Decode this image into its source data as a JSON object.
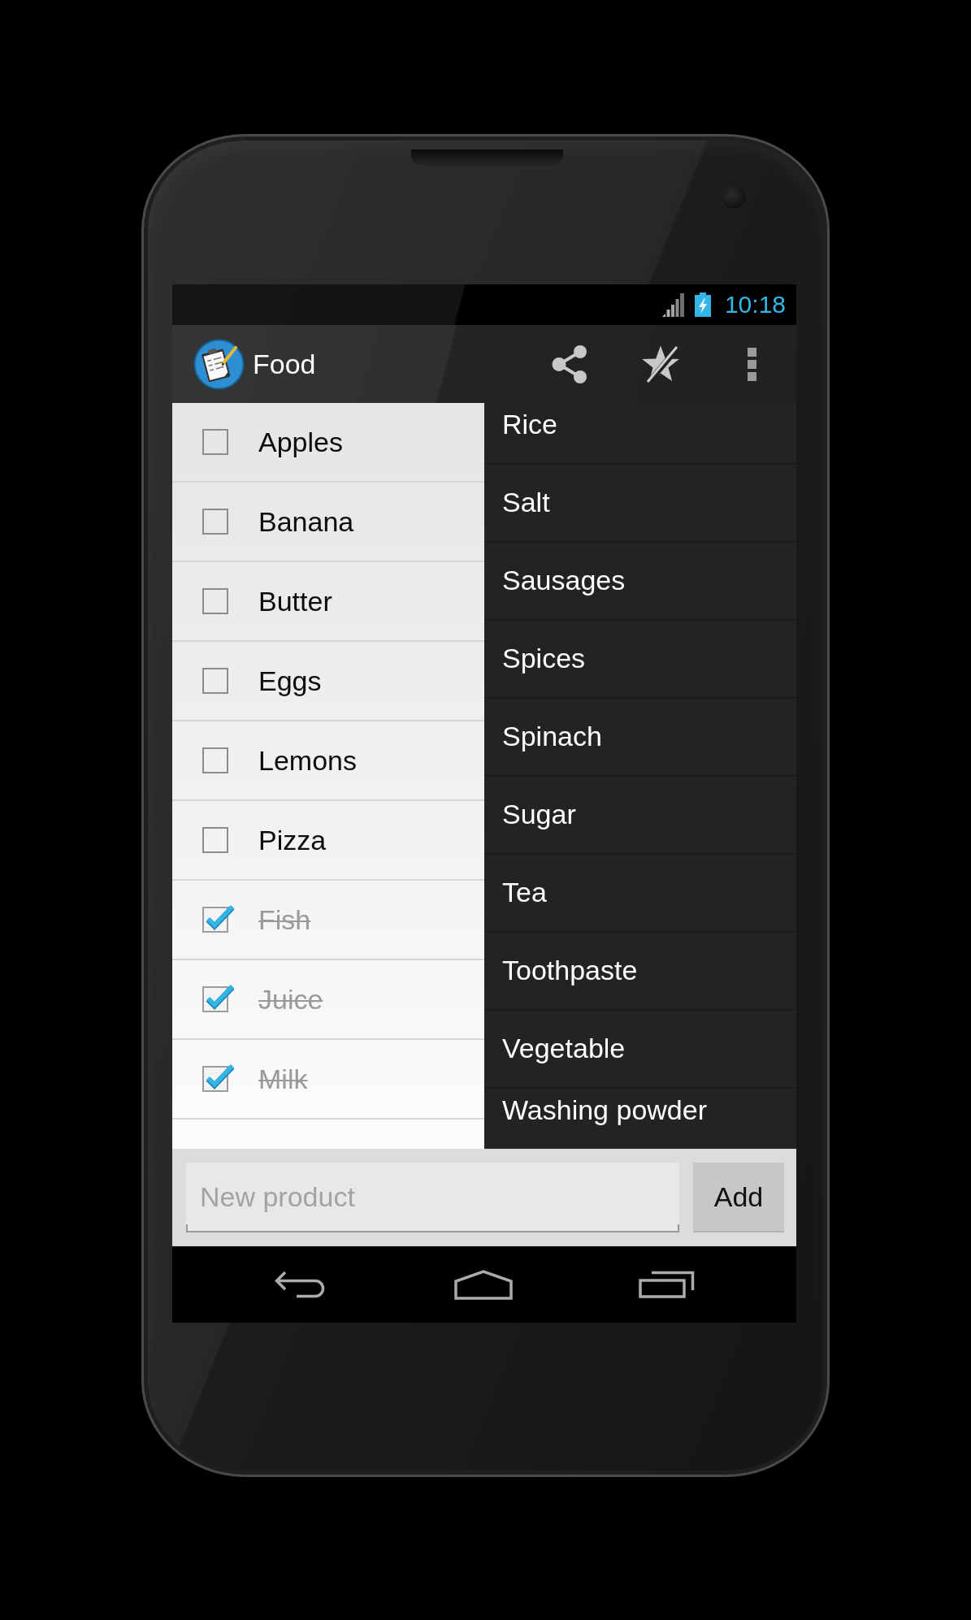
{
  "status_bar": {
    "time": "10:18"
  },
  "action_bar": {
    "title": "Food"
  },
  "checklist": {
    "items": [
      {
        "label": "Apples",
        "checked": false
      },
      {
        "label": "Banana",
        "checked": false
      },
      {
        "label": "Butter",
        "checked": false
      },
      {
        "label": "Eggs",
        "checked": false
      },
      {
        "label": "Lemons",
        "checked": false
      },
      {
        "label": "Pizza",
        "checked": false
      },
      {
        "label": "Fish",
        "checked": true
      },
      {
        "label": "Juice",
        "checked": true
      },
      {
        "label": "Milk",
        "checked": true
      }
    ]
  },
  "list": {
    "items": [
      "Rice",
      "Salt",
      "Sausages",
      "Spices",
      "Spinach",
      "Sugar",
      "Tea",
      "Toothpaste",
      "Vegetable",
      "Washing powder"
    ]
  },
  "entry_bar": {
    "placeholder": "New product",
    "button": "Add"
  }
}
